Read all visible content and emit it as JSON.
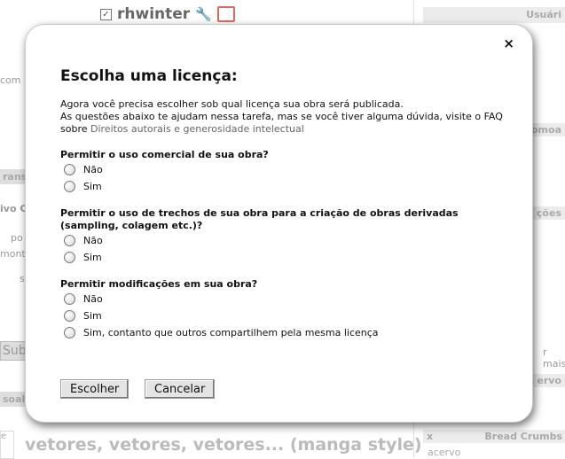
{
  "background": {
    "username": "rhwinter",
    "right_box_top": "Usuári",
    "side_labels": [
      "com",
      "tomoa",
      "ções",
      "ervo"
    ],
    "left_tabs": [
      "ransf",
      "ivo C",
      "soal"
    ],
    "left_fragments": [
      "po",
      "mont",
      "s"
    ],
    "more_link": "r mais",
    "submit_label": "Sub",
    "thumb_text": "e",
    "breadcrumbs_close": "x",
    "breadcrumbs_title": "Bread Crumbs",
    "breadcrumb_item": "acervo",
    "work_title": "vetores, vetores, vetores... (manga style)"
  },
  "dialog": {
    "close_label": "×",
    "title": "Escolha uma licença:",
    "intro_line1": "Agora você precisa escolher sob qual licença sua obra será publicada.",
    "intro_line2_prefix": "As questões abaixo te ajudam nessa tarefa, mas se você tiver alguma dúvida, visite o FAQ",
    "intro_line3_prefix": "sobre",
    "intro_link": "Direitos autorais e generosidade intelectual",
    "questions": [
      {
        "label": "Permitir o uso comercial de sua obra?",
        "options": [
          "Não",
          "Sim"
        ]
      },
      {
        "label": "Permitir o uso de trechos de sua obra para a criação de obras derivadas (sampling, colagem etc.)?",
        "options": [
          "Não",
          "Sim"
        ]
      },
      {
        "label": "Permitir modificações em sua obra?",
        "options": [
          "Não",
          "Sim",
          "Sim, contanto que outros compartilhem pela mesma licença"
        ]
      }
    ],
    "choose_button": "Escolher",
    "cancel_button": "Cancelar"
  }
}
